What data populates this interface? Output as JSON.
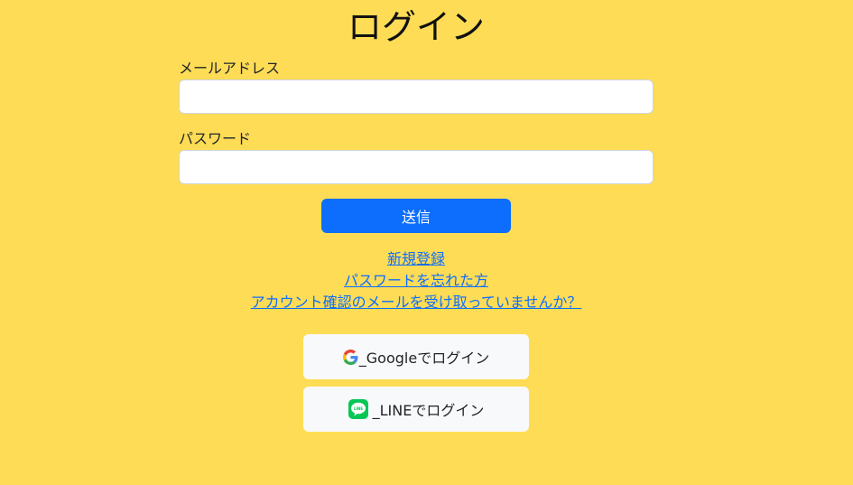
{
  "page": {
    "title": "ログイン"
  },
  "form": {
    "email_label": "メールアドレス",
    "email_value": "",
    "password_label": "パスワード",
    "password_value": "",
    "submit_label": "送信"
  },
  "links": {
    "signup": "新規登録",
    "forgot_password": "パスワードを忘れた方",
    "resend_confirmation": "アカウント確認のメールを受け取っていませんか？"
  },
  "social": {
    "google_label": "_Googleでログイン",
    "google_icon": "google-icon",
    "line_label": "_LINEでログイン",
    "line_icon": "line-icon",
    "line_icon_text": "LINE"
  },
  "colors": {
    "background": "#ffdc55",
    "primary": "#0d6efd",
    "line_green": "#06c755",
    "social_button_bg": "#f8f9fa"
  }
}
